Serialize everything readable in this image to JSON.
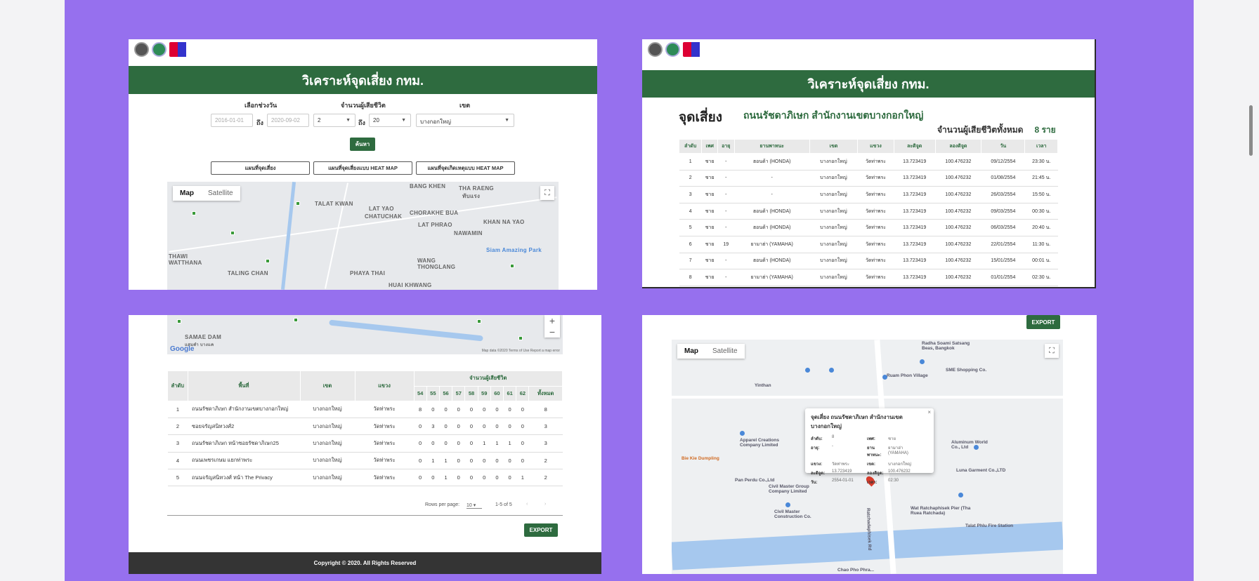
{
  "panel1": {
    "title": "วิเคราะห์จุดเสี่ยง กทม.",
    "date_range_label": "เลือกช่วงวัน",
    "victims_label": "จำนวนผู้เสียชีวิต",
    "district_label": "เขต",
    "date_from_placeholder": "2016-01-01",
    "date_to_placeholder": "2020-09-02",
    "to_word": "ถึง",
    "victims_from": "2",
    "victims_to": "20",
    "district_value": "บางกอกใหญ่",
    "search_button": "ค้นหา",
    "btn_risk_map": "แผนที่จุดเสี่ยง",
    "btn_risk_heatmap": "แผนที่จุดเสี่ยงแบบ HEAT MAP",
    "btn_accident_heatmap": "แผนที่จุดเกิดเหตุแบบ HEAT MAP",
    "map_tab": "Map",
    "satellite_tab": "Satellite",
    "places": [
      "BANG KHEN",
      "THA RAENG",
      "ทับแรง",
      "TALAT KWAN",
      "LAT YAO",
      "CHATUCHAK",
      "CHORAKHE BUA",
      "KHAN NA YAO",
      "LAT PHRAO",
      "NAWAMIN",
      "THAWI WATTHANA",
      "TALING CHAN",
      "PHAYA THAI",
      "WANG THONGLANG",
      "HUAI KHWANG",
      "Siam Amazing Park"
    ]
  },
  "panel2": {
    "title": "วิเคราะห์จุดเสี่ยง กทม.",
    "heading": "จุดเสี่ยง",
    "subheading": "ถนนรัชดาภิเษก สำนักงานเขตบางกอกใหญ่",
    "total_label": "จำนวนผู้เสียชีวิตทั้งหมด",
    "total_value": "8 ราย",
    "columns": [
      "ลำดับ",
      "เพศ",
      "อายุ",
      "ยานพาหนะ",
      "เขต",
      "แขวง",
      "ละติจูด",
      "ลองติจูด",
      "วัน",
      "เวลา"
    ],
    "rows": [
      [
        "1",
        "ชาย",
        "-",
        "ฮอนด้า (HONDA)",
        "บางกอกใหญ่",
        "วัดท่าพระ",
        "13.723419",
        "100.476232",
        "09/12/2554",
        "23:30 น."
      ],
      [
        "2",
        "ชาย",
        "-",
        "-",
        "บางกอกใหญ่",
        "วัดท่าพระ",
        "13.723419",
        "100.476232",
        "01/08/2554",
        "21:45 น."
      ],
      [
        "3",
        "ชาย",
        "-",
        "-",
        "บางกอกใหญ่",
        "วัดท่าพระ",
        "13.723419",
        "100.476232",
        "26/03/2554",
        "15:50 น."
      ],
      [
        "4",
        "ชาย",
        "-",
        "ฮอนด้า (HONDA)",
        "บางกอกใหญ่",
        "วัดท่าพระ",
        "13.723419",
        "100.476232",
        "09/03/2554",
        "00:30 น."
      ],
      [
        "5",
        "ชาย",
        "-",
        "ฮอนด้า (HONDA)",
        "บางกอกใหญ่",
        "วัดท่าพระ",
        "13.723419",
        "100.476232",
        "06/03/2554",
        "20:40 น."
      ],
      [
        "6",
        "ชาย",
        "19",
        "ยามาฮ่า (YAMAHA)",
        "บางกอกใหญ่",
        "วัดท่าพระ",
        "13.723419",
        "100.476232",
        "22/01/2554",
        "11:30 น."
      ],
      [
        "7",
        "ชาย",
        "-",
        "ฮอนด้า (HONDA)",
        "บางกอกใหญ่",
        "วัดท่าพระ",
        "13.723419",
        "100.476232",
        "15/01/2554",
        "00:01 น."
      ],
      [
        "8",
        "ชาย",
        "-",
        "ยามาฮ่า (YAMAHA)",
        "บางกอกใหญ่",
        "วัดท่าพระ",
        "13.723419",
        "100.476232",
        "01/01/2554",
        "02:30 น."
      ]
    ]
  },
  "panel3": {
    "map_places": [
      "SAMAE DAM",
      "แสมดำ บางแค"
    ],
    "map_footer": "Map data ©2020  Terms of Use  Report a map error",
    "google": "Google",
    "columns": {
      "no": "ลำดับ",
      "area": "พื้นที่",
      "district": "เขต",
      "subdistrict": "แขวง",
      "victims": "จำนวนผู้เสียชีวิต",
      "years": [
        "54",
        "55",
        "56",
        "57",
        "58",
        "59",
        "60",
        "61",
        "62"
      ],
      "total": "ทั้งหมด"
    },
    "rows": [
      {
        "no": "1",
        "area": "ถนนรัชดาภิเษก สำนักงานเขตบางกอกใหญ่",
        "district": "บางกอกใหญ่",
        "subdistrict": "วัดท่าพระ",
        "vals": [
          "8",
          "0",
          "0",
          "0",
          "0",
          "0",
          "0",
          "0",
          "0"
        ],
        "total": "8"
      },
      {
        "no": "2",
        "area": "ซอยจรัญสนิทวงศ์2",
        "district": "บางกอกใหญ่",
        "subdistrict": "วัดท่าพระ",
        "vals": [
          "0",
          "3",
          "0",
          "0",
          "0",
          "0",
          "0",
          "0",
          "0"
        ],
        "total": "3"
      },
      {
        "no": "3",
        "area": "ถนนรัชดาภิเษก หน้าซอยรัชดาภิเษก25",
        "district": "บางกอกใหญ่",
        "subdistrict": "วัดท่าพระ",
        "vals": [
          "0",
          "0",
          "0",
          "0",
          "0",
          "1",
          "1",
          "1",
          "0"
        ],
        "total": "3"
      },
      {
        "no": "4",
        "area": "ถนนเพชรเกษม แยกท่าพระ",
        "district": "บางกอกใหญ่",
        "subdistrict": "วัดท่าพระ",
        "vals": [
          "0",
          "1",
          "1",
          "0",
          "0",
          "0",
          "0",
          "0",
          "0"
        ],
        "total": "2"
      },
      {
        "no": "5",
        "area": "ถนนจรัญสนิทวงศ์ หน้า The Privacy",
        "district": "บางกอกใหญ่",
        "subdistrict": "วัดท่าพระ",
        "vals": [
          "0",
          "0",
          "1",
          "0",
          "0",
          "0",
          "0",
          "0",
          "1"
        ],
        "total": "2"
      }
    ],
    "rows_per_page_label": "Rows per page:",
    "rows_per_page_value": "10",
    "range_text": "1-5 of 5",
    "export": "EXPORT",
    "footer": "Copyright © 2020. All Rights Reserved"
  },
  "panel4": {
    "export": "EXPORT",
    "map_tab": "Map",
    "satellite_tab": "Satellite",
    "popup": {
      "title": "จุดเสี่ยง ถนนรัชดาภิเษก สำนักงานเขตบางกอกใหญ่",
      "rows": [
        [
          {
            "k": "ลำดับ:",
            "v": "8"
          },
          {
            "k": "เพศ:",
            "v": "ชาย"
          }
        ],
        [
          {
            "k": "อายุ:",
            "v": "-"
          },
          {
            "k": "ยานพาหนะ:",
            "v": "ยามาฮ่า (YAMAHA)"
          }
        ],
        [
          {
            "k": "แขวง:",
            "v": "วัดท่าพระ"
          },
          {
            "k": "เขต:",
            "v": "บางกอกใหญ่"
          }
        ],
        [
          {
            "k": "ละติจูด:",
            "v": "13.723419"
          },
          {
            "k": "ลองติจูด:",
            "v": "100.476232"
          }
        ],
        [
          {
            "k": "วัน:",
            "v": "2554-01-01"
          },
          {
            "k": "เวลา:",
            "v": "02:30"
          }
        ]
      ]
    },
    "pois": [
      "Radha Soami Satsang Beas, Bangkok",
      "SME Shopping Co.",
      "Ruam Phon Village",
      "Yinthan",
      "Apparel Creations Company Limited",
      "Pan Perdu Co.,Ltd",
      "Civil Master Group Company Limited",
      "Civil Master Construction Co.",
      "Aluminum World Co., Ltd",
      "Luna Garment Co.,LTD",
      "Wat Ratchaphisek Pier (Tha Ruea Ratchada)",
      "Talat Phlu Fire Station",
      "Bie Kie Dumpling",
      "Chao Pho Phra...",
      "Ratchadaphisek Rd"
    ]
  }
}
